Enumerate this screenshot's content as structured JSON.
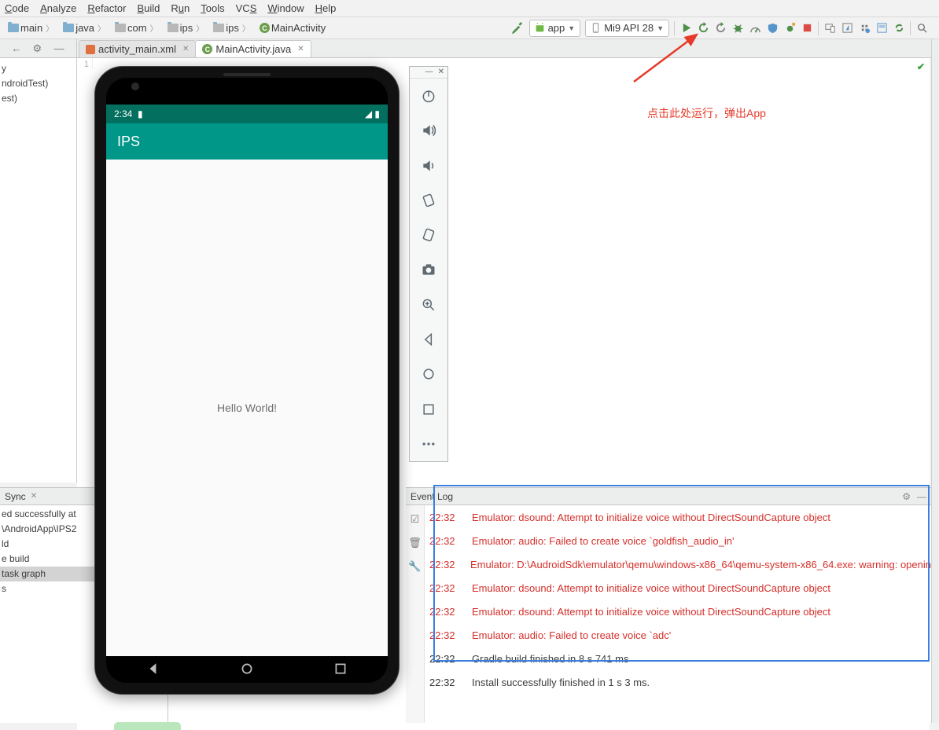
{
  "menu": [
    "Code",
    "Analyze",
    "Refactor",
    "Build",
    "Run",
    "Tools",
    "VCS",
    "Window",
    "Help"
  ],
  "menu_u": [
    "C",
    "A",
    "R",
    "B",
    "R",
    "T",
    "V",
    "W",
    "H"
  ],
  "breadcrumb": [
    "main",
    "java",
    "com",
    "ips",
    "ips",
    "MainActivity"
  ],
  "run_config": {
    "app": "app",
    "device": "Mi9 API 28"
  },
  "tabs": [
    {
      "label": "activity_main.xml",
      "type": "xml",
      "active": false
    },
    {
      "label": "MainActivity.java",
      "type": "class",
      "active": true
    }
  ],
  "left_tree": {
    "items": [
      "y",
      "ndroidTest)",
      "est)"
    ]
  },
  "gutter_line": "1",
  "annotation": "点击此处运行，弹出App",
  "phone": {
    "time": "2:34",
    "app_title": "IPS",
    "content": "Hello World!"
  },
  "sync": {
    "tab": "Sync",
    "lines": [
      {
        "t": "ed successfully at ",
        "ts": "",
        "ico": ""
      },
      {
        "t": "\\AndroidApp\\IPS2",
        "ico": "⇲"
      },
      {
        "t": "ld",
        "ico": ""
      },
      {
        "t": "e build",
        "ico": "⇲"
      },
      {
        "t": " task graph",
        "hl": true,
        "ico": "⇲"
      },
      {
        "t": "s",
        "ico": "⇲"
      }
    ]
  },
  "event_log": {
    "title": "Event Log",
    "rows": [
      {
        "time": "22:32",
        "msg": "Emulator: dsound: Attempt to initialize voice without DirectSoundCapture object",
        "err": true
      },
      {
        "time": "22:32",
        "msg": "Emulator: audio: Failed to create voice `goldfish_audio_in'",
        "err": true
      },
      {
        "time": "22:32",
        "msg": "Emulator: D:\\AudroidSdk\\emulator\\qemu\\windows-x86_64\\qemu-system-x86_64.exe: warning: openin",
        "err": true
      },
      {
        "time": "22:32",
        "msg": "Emulator: dsound: Attempt to initialize voice without DirectSoundCapture object",
        "err": true
      },
      {
        "time": "22:32",
        "msg": "Emulator: dsound: Attempt to initialize voice without DirectSoundCapture object",
        "err": true
      },
      {
        "time": "22:32",
        "msg": "Emulator: audio: Failed to create voice `adc'",
        "err": true
      },
      {
        "time": "22:32",
        "msg": "Gradle build finished in 8 s 741 ms",
        "err": false
      },
      {
        "time": "22:32",
        "msg": "Install successfully finished in 1 s 3 ms.",
        "err": false
      }
    ]
  }
}
